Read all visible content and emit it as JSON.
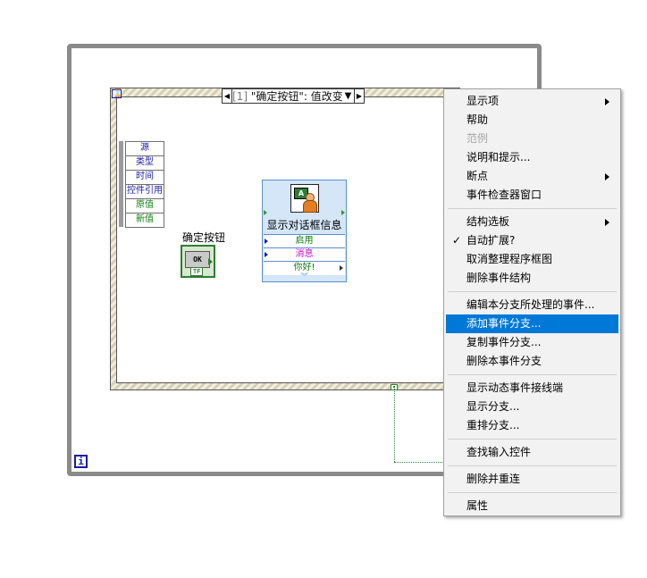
{
  "iteration_terminal": "i",
  "timeout_terminal": "⌛",
  "event_selector": {
    "index": "[1]",
    "label": "\"确定按钮\": 值改变"
  },
  "event_data_node": [
    "源",
    "类型",
    "时间",
    "控件引用",
    "原值",
    "新值"
  ],
  "button": {
    "label": "确定按钮",
    "face": "OK",
    "type_badge": "TF"
  },
  "dialog_vi": {
    "title": "显示对话框信息",
    "icon_text": "A",
    "inputs": [
      "启用",
      "消息",
      "你好!"
    ]
  },
  "context_menu": {
    "groups": [
      [
        {
          "label": "显示项",
          "submenu": true
        },
        {
          "label": "帮助"
        },
        {
          "label": "范例",
          "disabled": true
        },
        {
          "label": "说明和提示..."
        },
        {
          "label": "断点",
          "submenu": true
        },
        {
          "label": "事件检查器窗口"
        }
      ],
      [
        {
          "label": "结构选板",
          "submenu": true
        },
        {
          "label": "自动扩展?",
          "checked": true
        },
        {
          "label": "取消整理程序框图"
        },
        {
          "label": "删除事件结构"
        }
      ],
      [
        {
          "label": "编辑本分支所处理的事件..."
        },
        {
          "label": "添加事件分支...",
          "selected": true
        },
        {
          "label": "复制事件分支..."
        },
        {
          "label": "删除本事件分支"
        }
      ],
      [
        {
          "label": "显示动态事件接线端"
        },
        {
          "label": "显示分支..."
        },
        {
          "label": "重排分支..."
        }
      ],
      [
        {
          "label": "查找输入控件"
        }
      ],
      [
        {
          "label": "删除并重连"
        }
      ],
      [
        {
          "label": "属性"
        }
      ]
    ]
  },
  "colors": {
    "menu_highlight": "#0078d7",
    "boolean_green": "#2e7d32",
    "string_magenta": "#cc00cc",
    "numeric_blue": "#1a1aa8"
  }
}
